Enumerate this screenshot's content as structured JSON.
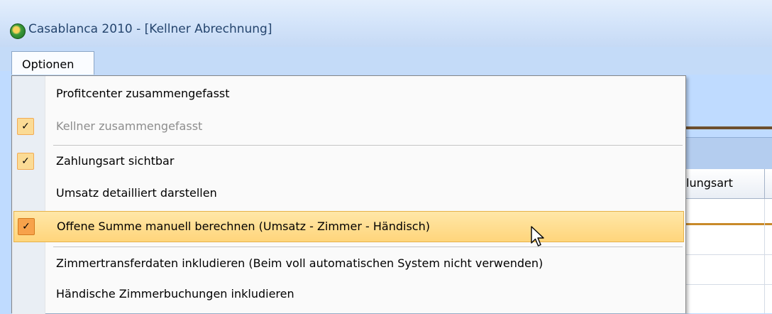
{
  "window": {
    "title": "Casablanca 2010 - [Kellner Abrechnung]"
  },
  "menubar": {
    "optionen_label": "Optionen"
  },
  "grid": {
    "column_header": "lungsart"
  },
  "menu": {
    "items": [
      {
        "label": "Profitcenter zusammengefasst",
        "checked": false,
        "enabled": true,
        "highlighted": false
      },
      {
        "label": "Kellner zusammengefasst",
        "checked": true,
        "enabled": false,
        "highlighted": false
      },
      {
        "label": "Zahlungsart sichtbar",
        "checked": true,
        "enabled": true,
        "highlighted": false
      },
      {
        "label": "Umsatz detailliert darstellen",
        "checked": false,
        "enabled": true,
        "highlighted": false
      },
      {
        "label": "Offene Summe manuell berechnen (Umsatz - Zimmer - Händisch)",
        "checked": true,
        "enabled": true,
        "highlighted": true
      },
      {
        "label": "Zimmertransferdaten inkludieren (Beim voll automatischen System nicht verwenden)",
        "checked": false,
        "enabled": true,
        "highlighted": false
      },
      {
        "label": "Händische Zimmerbuchungen inkludieren",
        "checked": false,
        "enabled": true,
        "highlighted": false
      }
    ],
    "check_glyph": "✓"
  }
}
